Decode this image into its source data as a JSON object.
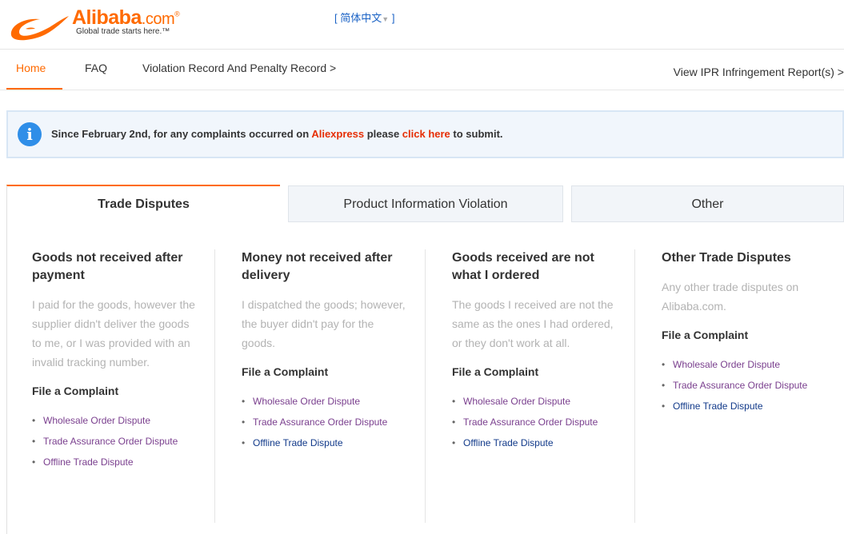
{
  "header": {
    "logo_word": "Alibaba",
    "logo_com": ".com",
    "logo_reg": "®",
    "tagline": "Global trade starts here.™",
    "language": "简体中文",
    "brand_color": "#ff6a00"
  },
  "nav": {
    "items": [
      {
        "label": "Home",
        "active": true
      },
      {
        "label": "FAQ",
        "active": false
      },
      {
        "label": "Violation Record And Penalty Record >",
        "active": false
      }
    ],
    "right_link": "View IPR Infringement Report(s) >"
  },
  "notice": {
    "icon": "info-icon",
    "text_before": "Since February 2nd, for any complaints occurred on ",
    "aliexpress": "Aliexpress",
    "text_middle": " please ",
    "click_here": "click here",
    "text_after": " to submit."
  },
  "tabs": [
    {
      "label": "Trade Disputes",
      "active": true
    },
    {
      "label": "Product Information Violation",
      "active": false
    },
    {
      "label": "Other",
      "active": false
    }
  ],
  "columns": [
    {
      "title": "Goods not received after payment",
      "description": "I paid for the goods, however the supplier didn't deliver the goods to me, or I was provided with an invalid tracking number.",
      "file_label": "File a Complaint",
      "links": [
        "Wholesale Order Dispute",
        "Trade Assurance Order Dispute",
        "Offline Trade Dispute"
      ]
    },
    {
      "title": "Money not received after delivery",
      "description": "I dispatched the goods; however, the buyer didn't pay for the goods.",
      "file_label": "File a Complaint",
      "links": [
        "Wholesale Order Dispute",
        "Trade Assurance Order Dispute",
        "Offline Trade Dispute"
      ]
    },
    {
      "title": "Goods received are not what I ordered",
      "description": "The goods I received are not the same as the ones I had ordered, or they don't work at all.",
      "file_label": "File a Complaint",
      "links": [
        "Wholesale Order Dispute",
        "Trade Assurance Order Dispute",
        "Offline Trade Dispute"
      ]
    },
    {
      "title": "Other Trade Disputes",
      "description": "Any other trade disputes on Alibaba.com.",
      "file_label": "File a Complaint",
      "links": [
        "Wholesale Order Dispute",
        "Trade Assurance Order Dispute",
        "Offline Trade Dispute"
      ]
    }
  ]
}
